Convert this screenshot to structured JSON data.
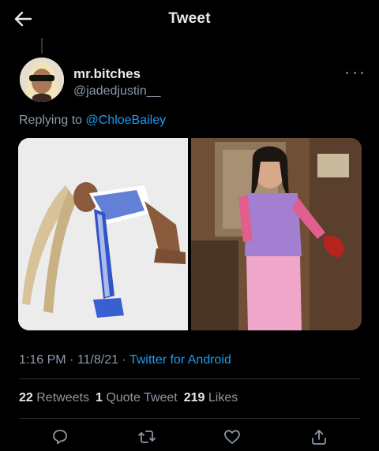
{
  "header": {
    "title": "Tweet",
    "back_icon": "arrow-left-icon"
  },
  "author": {
    "display_name": "mr.bitches",
    "handle": "@jadedjustin__"
  },
  "reply": {
    "prefix": "Replying to",
    "mention": "@ChloeBailey"
  },
  "meta": {
    "time": "1:16 PM",
    "separator": " · ",
    "date": "11/8/21",
    "source": "Twitter for Android"
  },
  "stats": {
    "retweets": {
      "count": "22",
      "label": "Retweets"
    },
    "quotes": {
      "count": "1",
      "label": "Quote Tweet"
    },
    "likes": {
      "count": "219",
      "label": "Likes"
    }
  },
  "actions": [
    "reply-icon",
    "retweet-icon",
    "like-icon",
    "share-icon"
  ],
  "colors": {
    "background": "#000000",
    "accent": "#1d9bf0",
    "secondary_text": "#8b98a5",
    "primary_text": "#e7e9ea"
  }
}
